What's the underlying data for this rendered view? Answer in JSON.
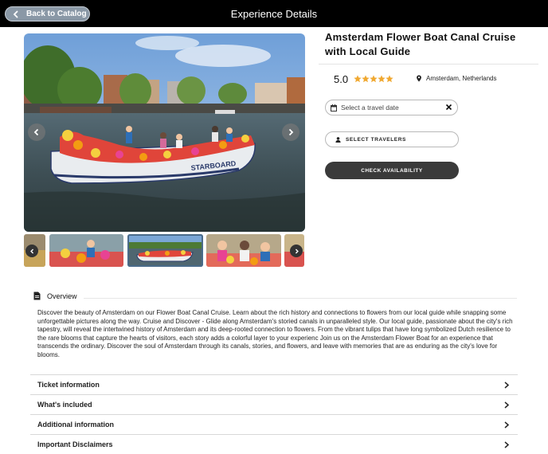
{
  "header": {
    "back_label": "Back to Catalog",
    "title": "Experience Details"
  },
  "gallery": {
    "main_image": "canal-boat-with-flowers",
    "thumbnails": [
      "people-on-flower-boat",
      "flower-boat-on-canal",
      "guests-with-flowers"
    ],
    "active_thumbnail": 1
  },
  "product": {
    "title": "Amsterdam Flower Boat Canal Cruise with Local Guide",
    "rating": "5.0",
    "stars": 5,
    "location": "Amsterdam, Netherlands"
  },
  "booking": {
    "date_placeholder": "Select a travel date",
    "travelers_label": "SELECT TRAVELERS",
    "availability_label": "CHECK AVAILABILITY"
  },
  "overview": {
    "heading": "Overview",
    "text": "Discover the beauty of Amsterdam on our Flower Boat Canal Cruise. Learn about the rich history and connections to flowers from our local guide while snapping some unforgettable pictures along the way. Cruise and Discover - Glide along Amsterdam's storied canals in unparalleled style. Our local guide, passionate about the city's rich tapestry, will reveal the intertwined history of Amsterdam and its deep-rooted connection to flowers. From the vibrant tulips that have long symbolized Dutch resilience to the rare blooms that capture the hearts of visitors, each story adds a colorful layer to your experienc Join us on the Amsterdam Flower Boat for an experience that transcends the ordinary. Discover the soul of Amsterdam through its canals, stories, and flowers, and leave with memories that are as enduring as the city's love for blooms."
  },
  "sections": [
    {
      "label": "Ticket information"
    },
    {
      "label": "What's included"
    },
    {
      "label": "Additional information"
    },
    {
      "label": "Important Disclaimers"
    }
  ],
  "colors": {
    "topbar": "#000000",
    "back_button": "#8a98a6",
    "star": "#f0a830",
    "primary_button": "#3a3a3a"
  }
}
